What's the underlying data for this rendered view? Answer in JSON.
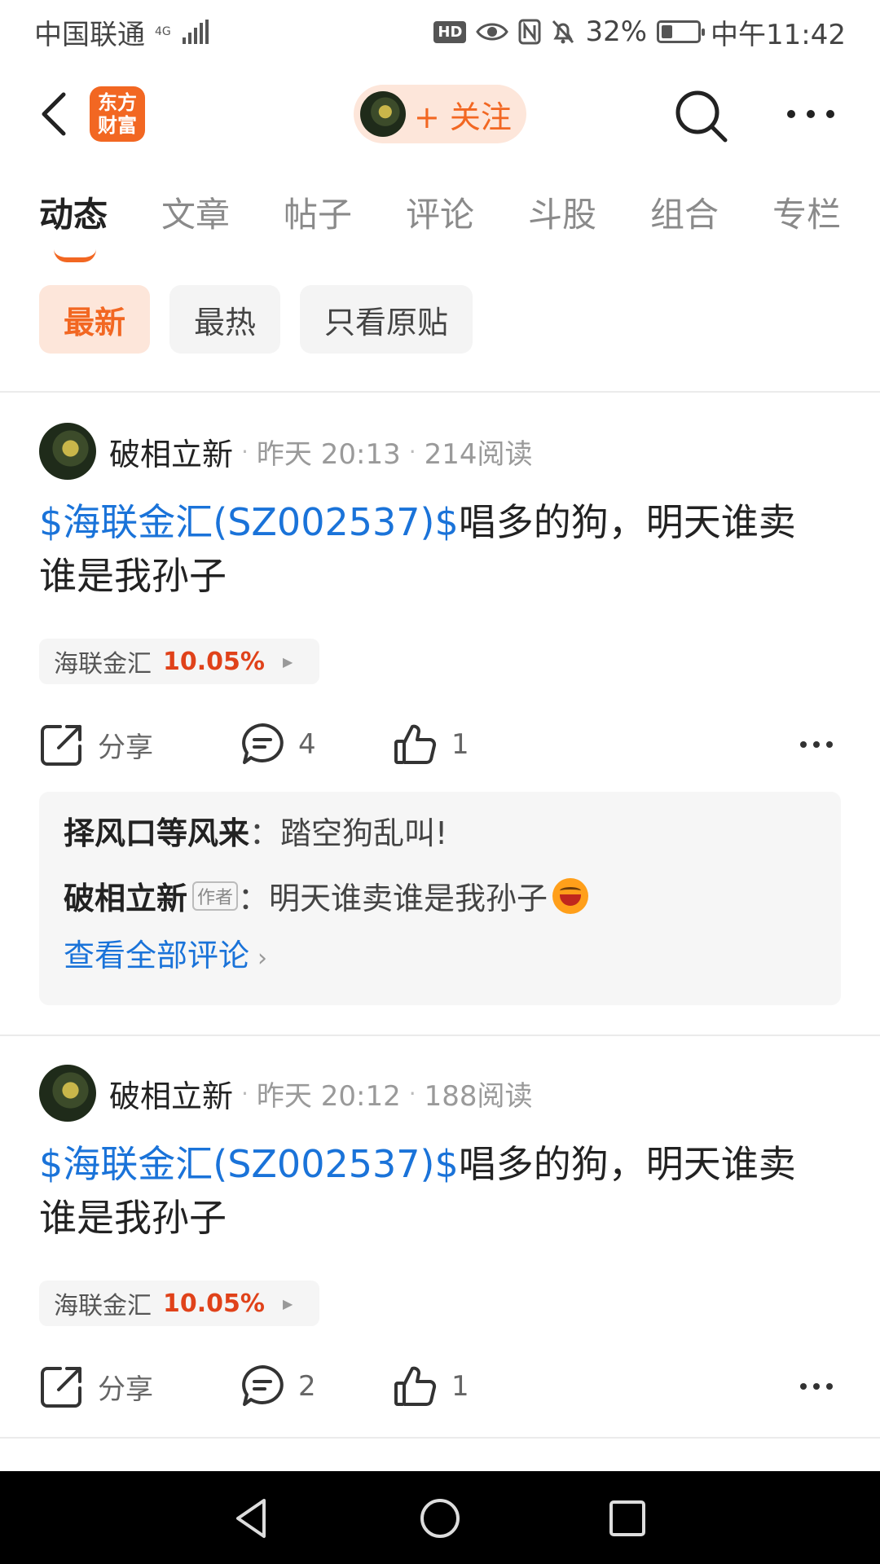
{
  "status_bar": {
    "carrier": "中国联通",
    "network": "4G",
    "hd": "HD",
    "battery_percent": "32%",
    "battery_level": 0.32,
    "time": "中午11:42"
  },
  "header": {
    "logo_text": [
      "东方",
      "财富"
    ],
    "follow_label": "+ 关注",
    "icons": [
      "back-arrow-icon",
      "search-icon",
      "more-icon"
    ]
  },
  "tabs": [
    "动态",
    "文章",
    "帖子",
    "评论",
    "斗股",
    "组合",
    "专栏"
  ],
  "filters": [
    "最新",
    "最热",
    "只看原贴"
  ],
  "posts": [
    {
      "author": "破相立新",
      "time": "昨天 20:13",
      "reads": "214阅读",
      "stock_link": "$海联金汇(SZ002537)$",
      "text": "唱多的狗，明天谁卖谁是我孙子",
      "stock_name": "海联金汇",
      "stock_change": "10.05%",
      "share_label": "分享",
      "comments": "4",
      "likes": "1",
      "comment_preview": [
        {
          "name": "择风口等风来",
          "text": "踏空狗乱叫!"
        },
        {
          "name": "破相立新",
          "badge": "作者",
          "text": "明天谁卖谁是我孙子"
        }
      ],
      "view_all": "查看全部评论"
    },
    {
      "author": "破相立新",
      "time": "昨天 20:12",
      "reads": "188阅读",
      "stock_link": "$海联金汇(SZ002537)$",
      "text": "唱多的狗，明天谁卖谁是我孙子",
      "stock_name": "海联金汇",
      "stock_change": "10.05%",
      "share_label": "分享",
      "comments": "2",
      "likes": "1"
    }
  ],
  "nav_bar": {
    "icons": [
      "back-triangle-icon",
      "home-circle-icon",
      "recents-square-icon"
    ]
  }
}
